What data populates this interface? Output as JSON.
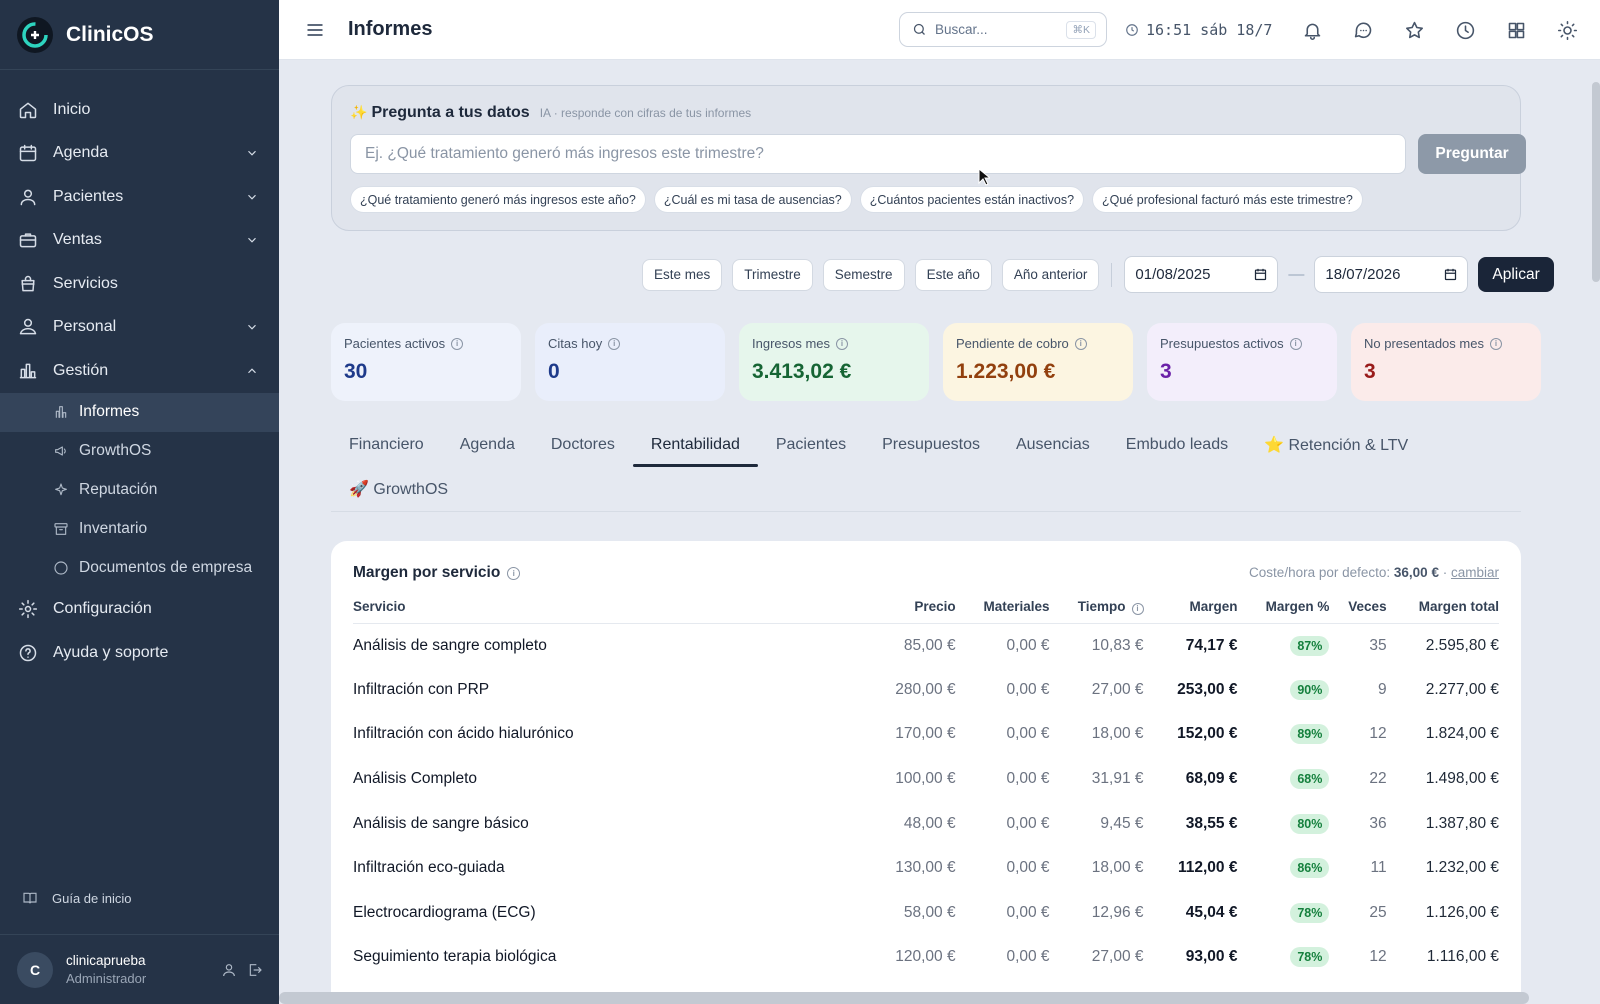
{
  "app": {
    "name": "ClinicOS"
  },
  "sidebar": {
    "items": [
      {
        "label": "Inicio"
      },
      {
        "label": "Agenda"
      },
      {
        "label": "Pacientes"
      },
      {
        "label": "Ventas"
      },
      {
        "label": "Servicios"
      },
      {
        "label": "Personal"
      },
      {
        "label": "Gestión"
      }
    ],
    "subitems": [
      {
        "label": "Informes"
      },
      {
        "label": "GrowthOS"
      },
      {
        "label": "Reputación"
      },
      {
        "label": "Inventario"
      },
      {
        "label": "Documentos de empresa"
      }
    ],
    "bottom_items": [
      {
        "label": "Configuración"
      },
      {
        "label": "Ayuda y soporte"
      }
    ],
    "guide": "Guía de inicio",
    "user": {
      "initial": "C",
      "name": "clinicaprueba",
      "role": "Administrador"
    }
  },
  "header": {
    "title": "Informes",
    "search_placeholder": "Buscar...",
    "shortcut": "⌘K",
    "clock": "16:51 sáb 18/7"
  },
  "ai": {
    "title": "Pregunta a tus datos",
    "subtitle": "IA · responde con cifras de tus informes",
    "placeholder": "Ej. ¿Qué tratamiento generó más ingresos este trimestre?",
    "button": "Preguntar",
    "suggestions": [
      "¿Qué tratamiento generó más ingresos este año?",
      "¿Cuál es mi tasa de ausencias?",
      "¿Cuántos pacientes están inactivos?",
      "¿Qué profesional facturó más este trimestre?"
    ]
  },
  "filters": {
    "presets": [
      "Este mes",
      "Trimestre",
      "Semestre",
      "Este año",
      "Año anterior"
    ],
    "date_from": "01/08/2025",
    "date_to": "18/07/2026",
    "apply": "Aplicar"
  },
  "kpis": [
    {
      "label": "Pacientes activos",
      "value": "30",
      "bg": "#eef2fb",
      "color": "#1e3a8a"
    },
    {
      "label": "Citas hoy",
      "value": "0",
      "bg": "#e9eefb",
      "color": "#1e3a8a"
    },
    {
      "label": "Ingresos mes",
      "value": "3.413,02 €",
      "bg": "#e6f6ec",
      "color": "#166534"
    },
    {
      "label": "Pendiente de cobro",
      "value": "1.223,00 €",
      "bg": "#fcf5e1",
      "color": "#92400e"
    },
    {
      "label": "Presupuestos activos",
      "value": "3",
      "bg": "#f3eefb",
      "color": "#6b21a8"
    },
    {
      "label": "No presentados mes",
      "value": "3",
      "bg": "#fbebea",
      "color": "#991b1b"
    }
  ],
  "tabs": [
    "Financiero",
    "Agenda",
    "Doctores",
    "Rentabilidad",
    "Pacientes",
    "Presupuestos",
    "Ausencias",
    "Embudo leads",
    "⭐ Retención & LTV"
  ],
  "tabs2": [
    "🚀 GrowthOS"
  ],
  "table": {
    "title": "Margen por servicio",
    "cost_label": "Coste/hora por defecto:",
    "cost_value": "36,00 €",
    "cost_sep": "·",
    "cost_link": "cambiar",
    "headers": [
      "Servicio",
      "Precio",
      "Materiales",
      "Tiempo",
      "Margen",
      "Margen %",
      "Veces",
      "Margen total"
    ],
    "rows": [
      [
        "Análisis de sangre completo",
        "85,00 €",
        "0,00 €",
        "10,83 €",
        "74,17 €",
        "87%",
        "35",
        "2.595,80 €"
      ],
      [
        "Infiltración con PRP",
        "280,00 €",
        "0,00 €",
        "27,00 €",
        "253,00 €",
        "90%",
        "9",
        "2.277,00 €"
      ],
      [
        "Infiltración con ácido hialurónico",
        "170,00 €",
        "0,00 €",
        "18,00 €",
        "152,00 €",
        "89%",
        "12",
        "1.824,00 €"
      ],
      [
        "Análisis Completo",
        "100,00 €",
        "0,00 €",
        "31,91 €",
        "68,09 €",
        "68%",
        "22",
        "1.498,00 €"
      ],
      [
        "Análisis de sangre básico",
        "48,00 €",
        "0,00 €",
        "9,45 €",
        "38,55 €",
        "80%",
        "36",
        "1.387,80 €"
      ],
      [
        "Infiltración eco-guiada",
        "130,00 €",
        "0,00 €",
        "18,00 €",
        "112,00 €",
        "86%",
        "11",
        "1.232,00 €"
      ],
      [
        "Electrocardiograma (ECG)",
        "58,00 €",
        "0,00 €",
        "12,96 €",
        "45,04 €",
        "78%",
        "25",
        "1.126,00 €"
      ],
      [
        "Seguimiento terapia biológica",
        "120,00 €",
        "0,00 €",
        "27,00 €",
        "93,00 €",
        "78%",
        "12",
        "1.116,00 €"
      ]
    ]
  }
}
